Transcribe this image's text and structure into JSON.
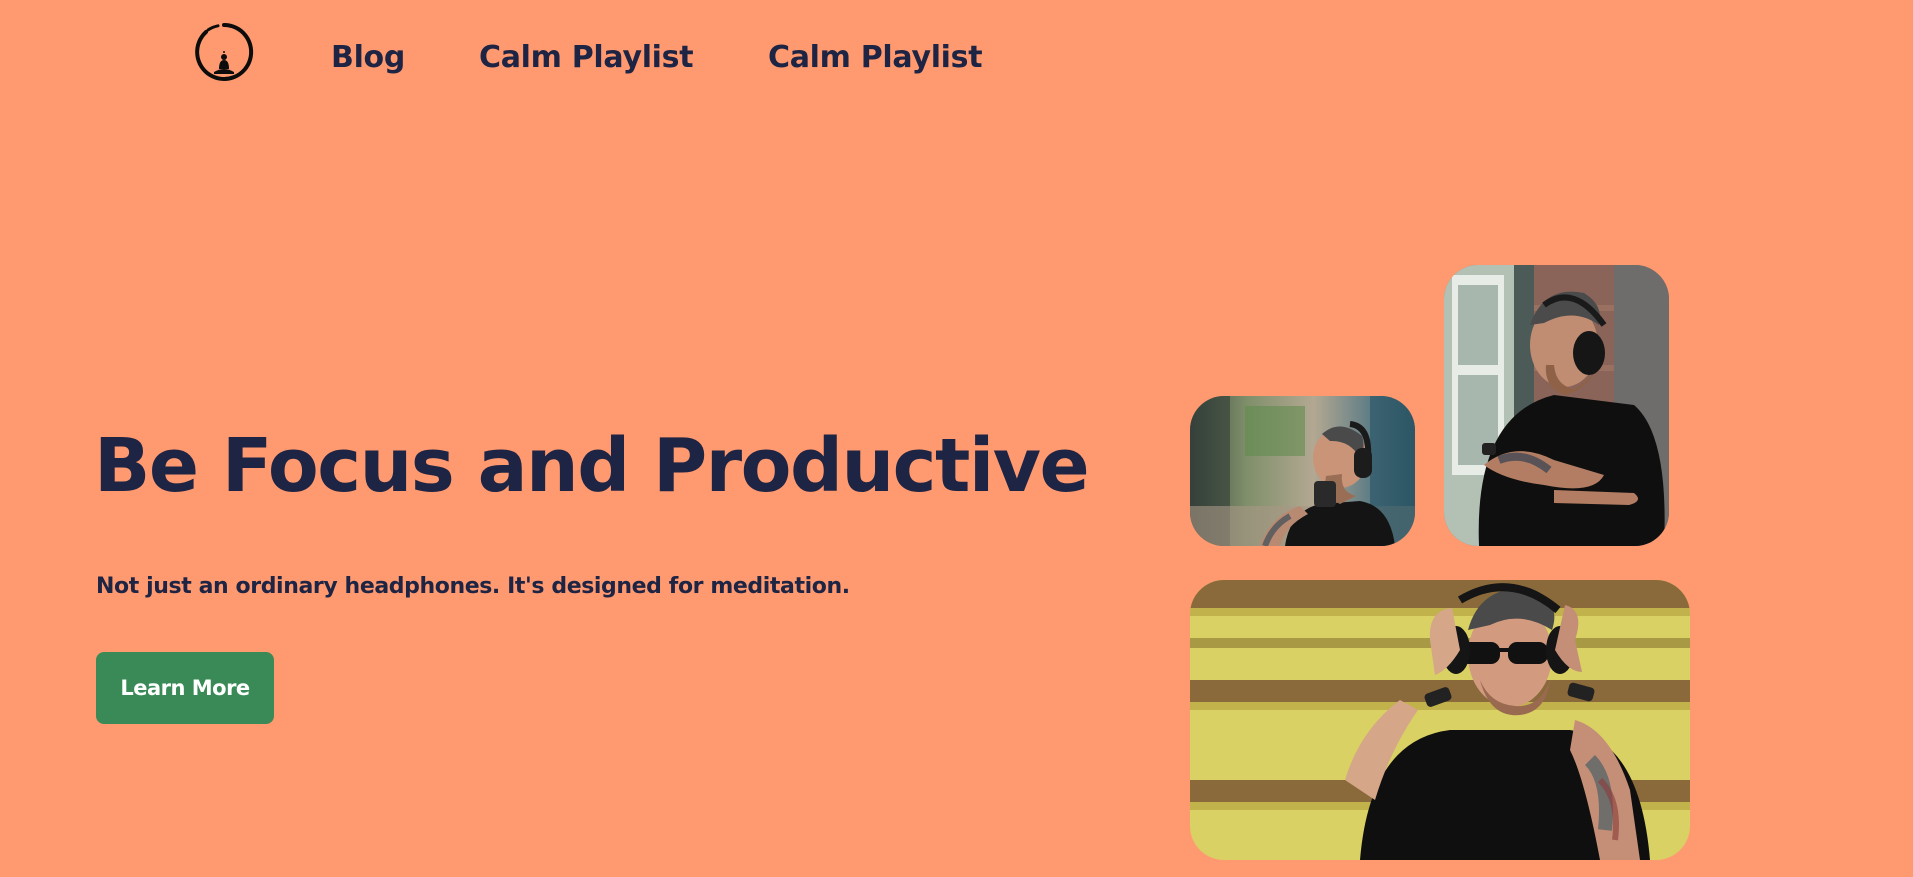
{
  "nav": {
    "logo_icon": "meditation-circle-icon",
    "links": [
      {
        "label": "Blog"
      },
      {
        "label": "Calm Playlist"
      },
      {
        "label": "Calm Playlist"
      }
    ]
  },
  "hero": {
    "title": "Be Focus and Productive",
    "subtitle": "Not just an ordinary headphones. It's designed for meditation.",
    "cta_label": "Learn More"
  },
  "colors": {
    "background": "#FF9A70",
    "text": "#1E2443",
    "cta": "#3A8A57",
    "cta_text": "#FFFFFF"
  }
}
